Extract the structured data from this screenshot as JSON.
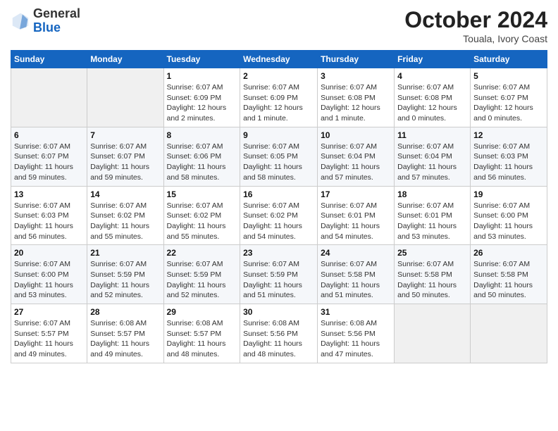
{
  "header": {
    "logo_general": "General",
    "logo_blue": "Blue",
    "month_title": "October 2024",
    "subtitle": "Touala, Ivory Coast"
  },
  "days_of_week": [
    "Sunday",
    "Monday",
    "Tuesday",
    "Wednesday",
    "Thursday",
    "Friday",
    "Saturday"
  ],
  "weeks": [
    [
      {
        "day": "",
        "info": ""
      },
      {
        "day": "",
        "info": ""
      },
      {
        "day": "1",
        "info": "Sunrise: 6:07 AM\nSunset: 6:09 PM\nDaylight: 12 hours\nand 2 minutes."
      },
      {
        "day": "2",
        "info": "Sunrise: 6:07 AM\nSunset: 6:09 PM\nDaylight: 12 hours\nand 1 minute."
      },
      {
        "day": "3",
        "info": "Sunrise: 6:07 AM\nSunset: 6:08 PM\nDaylight: 12 hours\nand 1 minute."
      },
      {
        "day": "4",
        "info": "Sunrise: 6:07 AM\nSunset: 6:08 PM\nDaylight: 12 hours\nand 0 minutes."
      },
      {
        "day": "5",
        "info": "Sunrise: 6:07 AM\nSunset: 6:07 PM\nDaylight: 12 hours\nand 0 minutes."
      }
    ],
    [
      {
        "day": "6",
        "info": "Sunrise: 6:07 AM\nSunset: 6:07 PM\nDaylight: 11 hours\nand 59 minutes."
      },
      {
        "day": "7",
        "info": "Sunrise: 6:07 AM\nSunset: 6:07 PM\nDaylight: 11 hours\nand 59 minutes."
      },
      {
        "day": "8",
        "info": "Sunrise: 6:07 AM\nSunset: 6:06 PM\nDaylight: 11 hours\nand 58 minutes."
      },
      {
        "day": "9",
        "info": "Sunrise: 6:07 AM\nSunset: 6:05 PM\nDaylight: 11 hours\nand 58 minutes."
      },
      {
        "day": "10",
        "info": "Sunrise: 6:07 AM\nSunset: 6:04 PM\nDaylight: 11 hours\nand 57 minutes."
      },
      {
        "day": "11",
        "info": "Sunrise: 6:07 AM\nSunset: 6:04 PM\nDaylight: 11 hours\nand 57 minutes."
      },
      {
        "day": "12",
        "info": "Sunrise: 6:07 AM\nSunset: 6:03 PM\nDaylight: 11 hours\nand 56 minutes."
      }
    ],
    [
      {
        "day": "13",
        "info": "Sunrise: 6:07 AM\nSunset: 6:03 PM\nDaylight: 11 hours\nand 56 minutes."
      },
      {
        "day": "14",
        "info": "Sunrise: 6:07 AM\nSunset: 6:02 PM\nDaylight: 11 hours\nand 55 minutes."
      },
      {
        "day": "15",
        "info": "Sunrise: 6:07 AM\nSunset: 6:02 PM\nDaylight: 11 hours\nand 55 minutes."
      },
      {
        "day": "16",
        "info": "Sunrise: 6:07 AM\nSunset: 6:02 PM\nDaylight: 11 hours\nand 54 minutes."
      },
      {
        "day": "17",
        "info": "Sunrise: 6:07 AM\nSunset: 6:01 PM\nDaylight: 11 hours\nand 54 minutes."
      },
      {
        "day": "18",
        "info": "Sunrise: 6:07 AM\nSunset: 6:01 PM\nDaylight: 11 hours\nand 53 minutes."
      },
      {
        "day": "19",
        "info": "Sunrise: 6:07 AM\nSunset: 6:00 PM\nDaylight: 11 hours\nand 53 minutes."
      }
    ],
    [
      {
        "day": "20",
        "info": "Sunrise: 6:07 AM\nSunset: 6:00 PM\nDaylight: 11 hours\nand 53 minutes."
      },
      {
        "day": "21",
        "info": "Sunrise: 6:07 AM\nSunset: 5:59 PM\nDaylight: 11 hours\nand 52 minutes."
      },
      {
        "day": "22",
        "info": "Sunrise: 6:07 AM\nSunset: 5:59 PM\nDaylight: 11 hours\nand 52 minutes."
      },
      {
        "day": "23",
        "info": "Sunrise: 6:07 AM\nSunset: 5:59 PM\nDaylight: 11 hours\nand 51 minutes."
      },
      {
        "day": "24",
        "info": "Sunrise: 6:07 AM\nSunset: 5:58 PM\nDaylight: 11 hours\nand 51 minutes."
      },
      {
        "day": "25",
        "info": "Sunrise: 6:07 AM\nSunset: 5:58 PM\nDaylight: 11 hours\nand 50 minutes."
      },
      {
        "day": "26",
        "info": "Sunrise: 6:07 AM\nSunset: 5:58 PM\nDaylight: 11 hours\nand 50 minutes."
      }
    ],
    [
      {
        "day": "27",
        "info": "Sunrise: 6:07 AM\nSunset: 5:57 PM\nDaylight: 11 hours\nand 49 minutes."
      },
      {
        "day": "28",
        "info": "Sunrise: 6:08 AM\nSunset: 5:57 PM\nDaylight: 11 hours\nand 49 minutes."
      },
      {
        "day": "29",
        "info": "Sunrise: 6:08 AM\nSunset: 5:57 PM\nDaylight: 11 hours\nand 48 minutes."
      },
      {
        "day": "30",
        "info": "Sunrise: 6:08 AM\nSunset: 5:56 PM\nDaylight: 11 hours\nand 48 minutes."
      },
      {
        "day": "31",
        "info": "Sunrise: 6:08 AM\nSunset: 5:56 PM\nDaylight: 11 hours\nand 47 minutes."
      },
      {
        "day": "",
        "info": ""
      },
      {
        "day": "",
        "info": ""
      }
    ]
  ]
}
